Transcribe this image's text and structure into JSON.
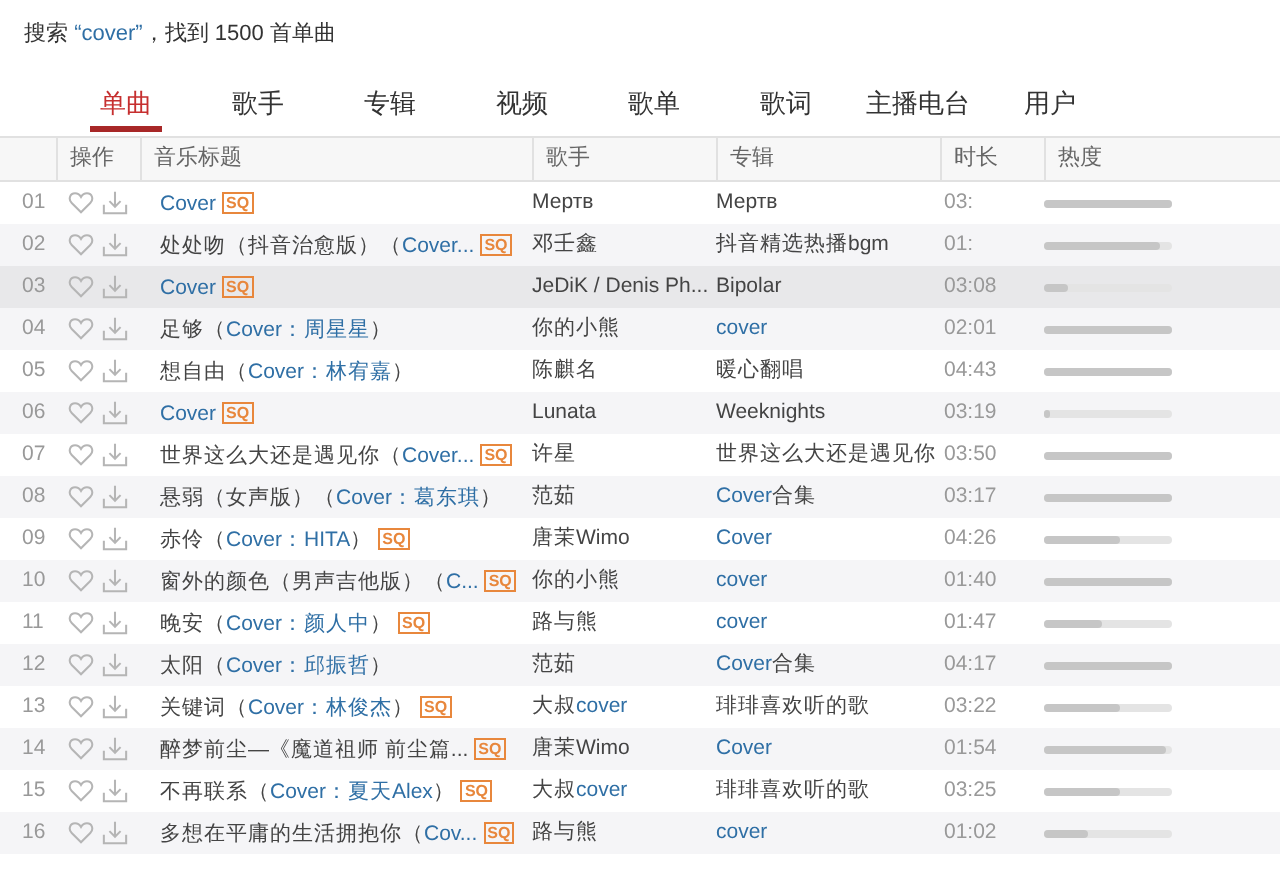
{
  "search_summary": [
    {
      "text": "搜索 ",
      "link": false
    },
    {
      "text": "“cover”",
      "link": true
    },
    {
      "text": "，找到 1500 首单曲",
      "link": false
    }
  ],
  "tabs": [
    {
      "label": "单曲",
      "selected": true
    },
    {
      "label": "歌手",
      "selected": false
    },
    {
      "label": "专辑",
      "selected": false
    },
    {
      "label": "视频",
      "selected": false
    },
    {
      "label": "歌单",
      "selected": false
    },
    {
      "label": "歌词",
      "selected": false
    },
    {
      "label": "主播电台",
      "selected": false
    },
    {
      "label": "用户",
      "selected": false
    }
  ],
  "table": {
    "columns": [
      "操作",
      "音乐标题",
      "歌手",
      "专辑",
      "时长",
      "热度"
    ],
    "rows": [
      {
        "index": "01",
        "selected": false,
        "title": [
          {
            "text": "Cover",
            "link": true
          }
        ],
        "badge": "SQ",
        "artist": [
          {
            "text": "Мертв",
            "link": false
          }
        ],
        "album": [
          {
            "text": "Мертв",
            "link": false
          }
        ],
        "duration": "03:",
        "level": 1
      },
      {
        "index": "02",
        "selected": false,
        "title": [
          {
            "text": "处处吻（抖音治愈版）（",
            "link": false
          },
          {
            "text": "Cover...",
            "link": true
          }
        ],
        "badge": "SQ",
        "artist": [
          {
            "text": "邓壬鑫",
            "link": false
          }
        ],
        "album": [
          {
            "text": "抖音精选热播bgm",
            "link": false
          }
        ],
        "duration": "01:",
        "level": 0.9
      },
      {
        "index": "03",
        "selected": true,
        "title": [
          {
            "text": "Cover",
            "link": true
          }
        ],
        "badge": "SQ",
        "artist": [
          {
            "text": "JeDiK / Denis Ph...",
            "link": false
          }
        ],
        "album": [
          {
            "text": "Bipolar",
            "link": false
          }
        ],
        "duration": "03:08",
        "level": 0.19
      },
      {
        "index": "04",
        "selected": false,
        "title": [
          {
            "text": "足够（",
            "link": false
          },
          {
            "text": "Cover：周星星",
            "link": true
          },
          {
            "text": "）",
            "link": false
          }
        ],
        "artist": [
          {
            "text": "你的小熊",
            "link": false
          }
        ],
        "album": [
          {
            "text": "cover",
            "link": true
          }
        ],
        "duration": "02:01",
        "level": 1
      },
      {
        "index": "05",
        "selected": false,
        "title": [
          {
            "text": "想自由（",
            "link": false
          },
          {
            "text": "Cover：林宥嘉",
            "link": true
          },
          {
            "text": "）",
            "link": false
          }
        ],
        "artist": [
          {
            "text": "陈麒名",
            "link": false
          }
        ],
        "album": [
          {
            "text": "暖心翻唱",
            "link": false
          }
        ],
        "duration": "04:43",
        "level": 1
      },
      {
        "index": "06",
        "selected": false,
        "title": [
          {
            "text": "Cover",
            "link": true
          }
        ],
        "badge": "SQ",
        "artist": [
          {
            "text": "Lunata",
            "link": false
          }
        ],
        "album": [
          {
            "text": "Weeknights",
            "link": false
          }
        ],
        "duration": "03:19",
        "level": 0.05
      },
      {
        "index": "07",
        "selected": false,
        "title": [
          {
            "text": "世界这么大还是遇见你（",
            "link": false
          },
          {
            "text": "Cover...",
            "link": true
          }
        ],
        "badge": "SQ",
        "artist": [
          {
            "text": "许星",
            "link": false
          }
        ],
        "album": [
          {
            "text": "世界这么大还是遇见你",
            "link": false
          }
        ],
        "duration": "03:50",
        "level": 1
      },
      {
        "index": "08",
        "selected": false,
        "title": [
          {
            "text": "悬弱（女声版）（",
            "link": false
          },
          {
            "text": "Cover：葛东琪",
            "link": true
          },
          {
            "text": "）",
            "link": false
          }
        ],
        "artist": [
          {
            "text": "范茹",
            "link": false
          }
        ],
        "album": [
          {
            "text": "Cover",
            "link": true
          },
          {
            "text": "合集",
            "link": false
          }
        ],
        "duration": "03:17",
        "level": 1
      },
      {
        "index": "09",
        "selected": false,
        "title": [
          {
            "text": "赤伶（",
            "link": false
          },
          {
            "text": "Cover：HITA",
            "link": true
          },
          {
            "text": "）",
            "link": false
          }
        ],
        "badge": "SQ",
        "artist": [
          {
            "text": "唐茉Wimo",
            "link": false
          }
        ],
        "album": [
          {
            "text": "Cover",
            "link": true
          }
        ],
        "duration": "04:26",
        "level": 0.6
      },
      {
        "index": "10",
        "selected": false,
        "title": [
          {
            "text": "窗外的颜色（男声吉他版）（",
            "link": false
          },
          {
            "text": "C...",
            "link": true
          }
        ],
        "badge": "SQ",
        "artist": [
          {
            "text": "你的小熊",
            "link": false
          }
        ],
        "album": [
          {
            "text": "cover",
            "link": true
          }
        ],
        "duration": "01:40",
        "level": 1
      },
      {
        "index": "11",
        "selected": false,
        "title": [
          {
            "text": "晚安（",
            "link": false
          },
          {
            "text": "Cover：颜人中",
            "link": true
          },
          {
            "text": "）",
            "link": false
          }
        ],
        "badge": "SQ",
        "artist": [
          {
            "text": "路与熊",
            "link": false
          }
        ],
        "album": [
          {
            "text": "cover",
            "link": true
          }
        ],
        "duration": "01:47",
        "level": 0.45
      },
      {
        "index": "12",
        "selected": false,
        "title": [
          {
            "text": "太阳（",
            "link": false
          },
          {
            "text": "Cover：邱振哲",
            "link": true
          },
          {
            "text": "）",
            "link": false
          }
        ],
        "artist": [
          {
            "text": "范茹",
            "link": false
          }
        ],
        "album": [
          {
            "text": "Cover",
            "link": true
          },
          {
            "text": "合集",
            "link": false
          }
        ],
        "duration": "04:17",
        "level": 1
      },
      {
        "index": "13",
        "selected": false,
        "title": [
          {
            "text": "关键词（",
            "link": false
          },
          {
            "text": "Cover：林俊杰",
            "link": true
          },
          {
            "text": "）",
            "link": false
          }
        ],
        "badge": "SQ",
        "artist": [
          {
            "text": "大叔",
            "link": false
          },
          {
            "text": "cover",
            "link": true
          }
        ],
        "album": [
          {
            "text": "琲琲喜欢听的歌",
            "link": false
          }
        ],
        "duration": "03:22",
        "level": 0.6
      },
      {
        "index": "14",
        "selected": false,
        "title": [
          {
            "text": "醉梦前尘—《魔道祖师 前尘篇...",
            "link": false
          }
        ],
        "badge": "SQ",
        "artist": [
          {
            "text": "唐茉Wimo",
            "link": false
          }
        ],
        "album": [
          {
            "text": "Cover",
            "link": true
          }
        ],
        "duration": "01:54",
        "level": 0.95
      },
      {
        "index": "15",
        "selected": false,
        "title": [
          {
            "text": "不再联系（",
            "link": false
          },
          {
            "text": "Cover：夏天Alex",
            "link": true
          },
          {
            "text": "）",
            "link": false
          }
        ],
        "badge": "SQ",
        "artist": [
          {
            "text": "大叔",
            "link": false
          },
          {
            "text": "cover",
            "link": true
          }
        ],
        "album": [
          {
            "text": "琲琲喜欢听的歌",
            "link": false
          }
        ],
        "duration": "03:25",
        "level": 0.6
      },
      {
        "index": "16",
        "selected": false,
        "title": [
          {
            "text": "多想在平庸的生活拥抱你（",
            "link": false
          },
          {
            "text": "Cov...",
            "link": true
          }
        ],
        "badge": "SQ",
        "artist": [
          {
            "text": "路与熊",
            "link": false
          }
        ],
        "album": [
          {
            "text": "cover",
            "link": true
          }
        ],
        "duration": "01:02",
        "level": 0.35
      }
    ]
  }
}
